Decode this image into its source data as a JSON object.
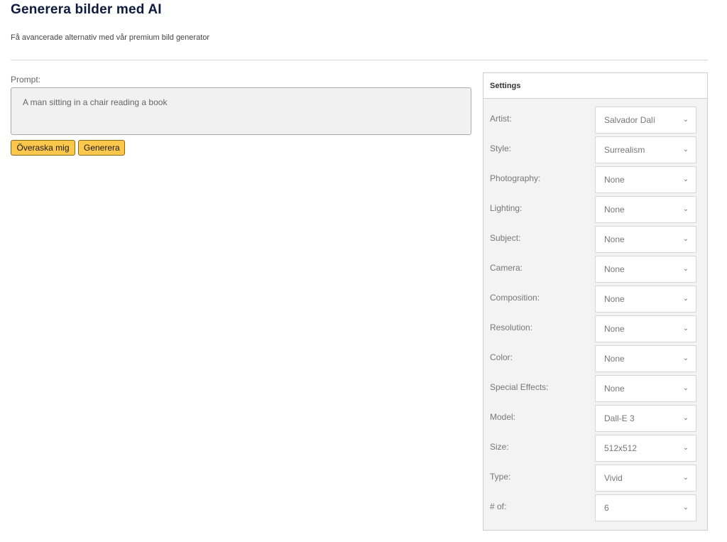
{
  "header": {
    "title": "Generera bilder med AI",
    "subtitle": "Få avancerade alternativ med vår premium bild generator"
  },
  "prompt": {
    "label": "Prompt:",
    "value": "A man sitting in a chair reading a book"
  },
  "buttons": {
    "surprise": "Överaska mig",
    "generate": "Generera"
  },
  "settings": {
    "title": "Settings",
    "rows": [
      {
        "label": "Artist:",
        "value": "Salvador Dalí"
      },
      {
        "label": "Style:",
        "value": "Surrealism"
      },
      {
        "label": "Photography:",
        "value": "None"
      },
      {
        "label": "Lighting:",
        "value": "None"
      },
      {
        "label": "Subject:",
        "value": "None"
      },
      {
        "label": "Camera:",
        "value": "None"
      },
      {
        "label": "Composition:",
        "value": "None"
      },
      {
        "label": "Resolution:",
        "value": "None"
      },
      {
        "label": "Color:",
        "value": "None"
      },
      {
        "label": "Special Effects:",
        "value": "None"
      },
      {
        "label": "Model:",
        "value": "Dall-E 3"
      },
      {
        "label": "Size:",
        "value": "512x512"
      },
      {
        "label": "Type:",
        "value": "Vivid"
      },
      {
        "label": "# of:",
        "value": "6"
      }
    ]
  },
  "icons": {
    "select_chevron": "chevron-down-icon"
  },
  "colors": {
    "button": "#fcc74a",
    "title": "#0d1b3e"
  }
}
